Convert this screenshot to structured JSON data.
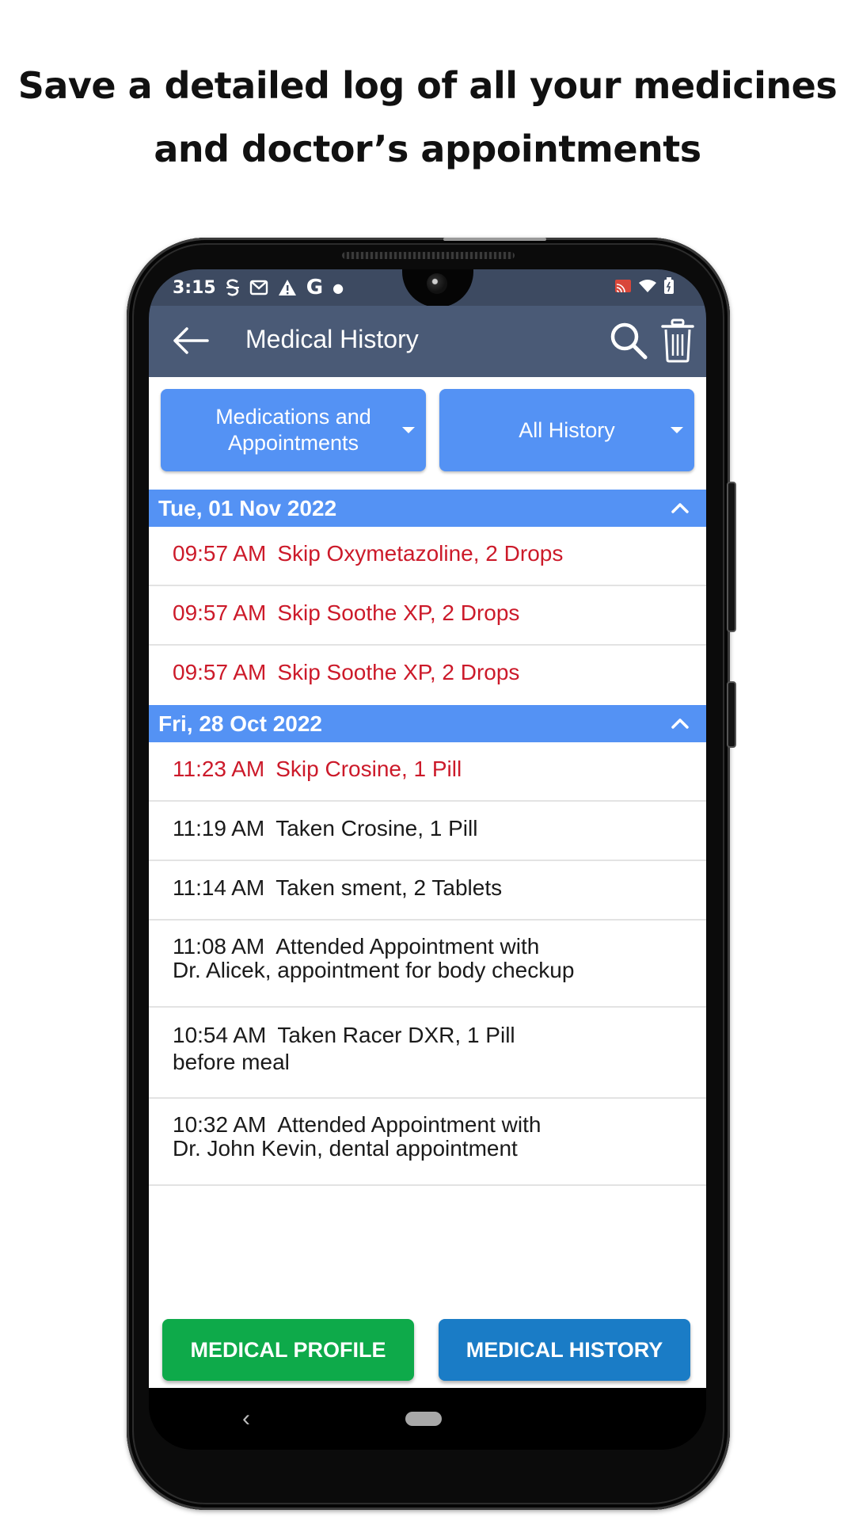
{
  "headline": {
    "line1": "Save a detailed log of all your medicines",
    "line2": "and doctor’s appointments"
  },
  "status_bar": {
    "time": "3:15",
    "left_icons": [
      "s-app-icon",
      "gmail-icon",
      "warning-icon",
      "google-icon",
      "dot-icon"
    ],
    "right_icons": [
      "cast-icon",
      "wifi-icon",
      "battery-icon"
    ]
  },
  "app_bar": {
    "title": "Medical History",
    "back_icon": "arrow-left-icon",
    "actions": [
      "search-icon",
      "trash-icon"
    ]
  },
  "filters": {
    "category": {
      "line1": "Medications and",
      "line2": "Appointments"
    },
    "range": "All History"
  },
  "sections": [
    {
      "date": "Tue, 01 Nov 2022",
      "expanded": true,
      "entries": [
        {
          "time": "09:57 AM",
          "text": "Skip Oxymetazoline, 2 Drops",
          "note": "",
          "status": "skip"
        },
        {
          "time": "09:57 AM",
          "text": "Skip Soothe XP, 2 Drops",
          "note": "",
          "status": "skip"
        },
        {
          "time": "09:57 AM",
          "text": "Skip Soothe XP, 2 Drops",
          "note": "",
          "status": "skip"
        }
      ]
    },
    {
      "date": "Fri, 28 Oct 2022",
      "expanded": true,
      "entries": [
        {
          "time": "11:23 AM",
          "text": "Skip Crosine, 1 Pill",
          "note": "",
          "status": "skip"
        },
        {
          "time": "11:19 AM",
          "text": "Taken Crosine, 1 Pill",
          "note": "",
          "status": "taken"
        },
        {
          "time": "11:14 AM",
          "text": "Taken sment, 2 Tablets",
          "note": "",
          "status": "taken"
        },
        {
          "time": "11:08 AM",
          "text": "Attended Appointment with",
          "note": "Dr. Alicek, appointment for body checkup",
          "status": "appointment"
        },
        {
          "time": "10:54 AM",
          "text": "Taken Racer DXR, 1 Pill",
          "note": "before meal",
          "status": "taken"
        },
        {
          "time": "10:32 AM",
          "text": "Attended Appointment with",
          "note": "Dr. John Kevin, dental appointment",
          "status": "appointment"
        }
      ]
    }
  ],
  "bottom_buttons": {
    "profile": "MEDICAL PROFILE",
    "history": "MEDICAL HISTORY"
  },
  "nav": {
    "back": "‹"
  },
  "colors": {
    "app_bar": "#4a5a76",
    "status_bar": "#3d4a61",
    "accent_blue": "#5492f4",
    "skip_red": "#cc1a2a",
    "profile_green": "#0eaa4a",
    "history_blue": "#1a7cc6"
  }
}
